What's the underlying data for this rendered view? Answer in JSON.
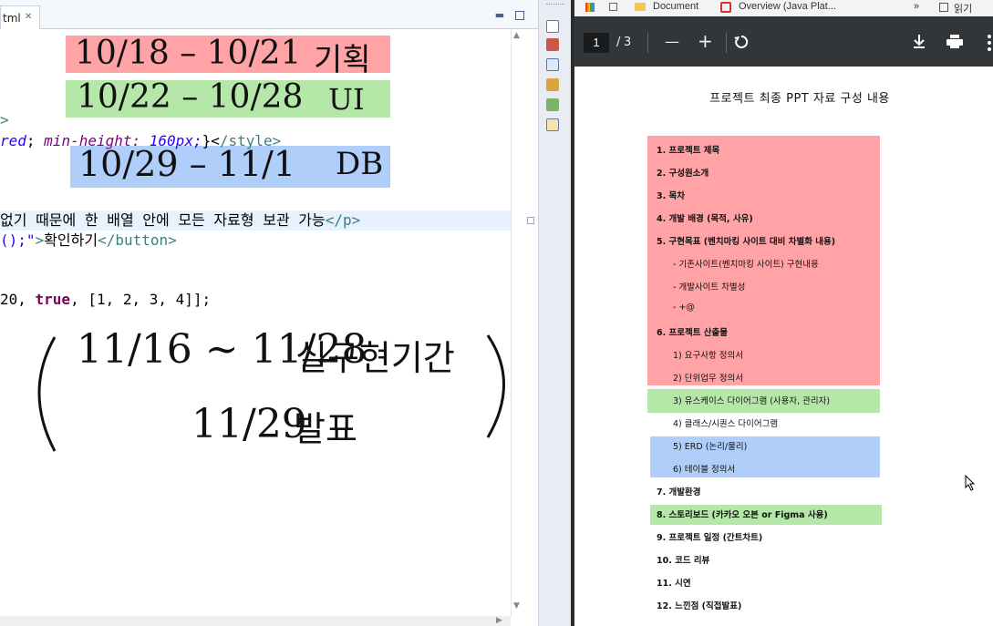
{
  "editor": {
    "tab_label": "tml",
    "code_lines": [
      ">",
      "red; min-height: 160px;}</style>",
      "없기 때문에 한 배열 안에 모든 자료형 보관 가능</p>",
      "();\">확인하기</button>",
      "20, true, [1, 2, 3, 4]];"
    ],
    "annotations": {
      "plan_dates": "10/18 – 10/21",
      "plan_label": "기획",
      "ui_dates": "10/22 – 10/28",
      "ui_label": "UI",
      "db_dates": "10/29 – 11/1",
      "db_label": "DB",
      "impl_dates": "11/16 ~ 11/28",
      "impl_label": "실구현기간",
      "present_date": "11/29",
      "present_label": "발표"
    },
    "band_colors": {
      "red": "#ffa3a6",
      "green": "#b5e8a8",
      "blue": "#afcef9"
    }
  },
  "bookmarks": {
    "items": [
      "Document",
      "Overview (Java Plat...",
      "»",
      "읽기"
    ]
  },
  "pdf": {
    "page_current": "1",
    "page_separator": "/",
    "page_total": "3",
    "zoom_out": "—",
    "zoom_in": "+",
    "title": "프로젝트 최종 PPT 자료 구성 내용",
    "items": [
      "1.  프로젝트 제목",
      "2.  구성원소개",
      "3.  목차",
      "4.  개발 배경 (목적, 사유)",
      "5.  구현목표  (벤치마킹 사이트 대비 차별화 내용)",
      "-     기존사이트(벤치마킹 사이트) 구현내용",
      "-     개발사이트 차별성",
      "-     +@",
      "6.  프로젝트 산출물",
      "1)   요구사항 정의서",
      "2)   단위업무 정의서",
      "3)   유스케이스 다이어그램 (사용자, 관리자)",
      "4)   클래스/시퀀스 다이어그램",
      "5)   ERD (논리/물리)",
      "6)   테이블 정의서",
      "7.  개발환경",
      "8.  스토리보드 (카카오 오븐 or Figma 사용)",
      "9.  프로젝트 일정 (간트차트)",
      "10. 코드 리뷰",
      "11. 시연",
      "12. 느낀점 (직접발표)"
    ],
    "highlight_colors": {
      "red": "#ffa3a6",
      "green": "#b5e8a8",
      "blue": "#afcef9"
    },
    "icons": [
      "download-icon",
      "print-icon",
      "more-icon",
      "rotate-icon"
    ]
  }
}
